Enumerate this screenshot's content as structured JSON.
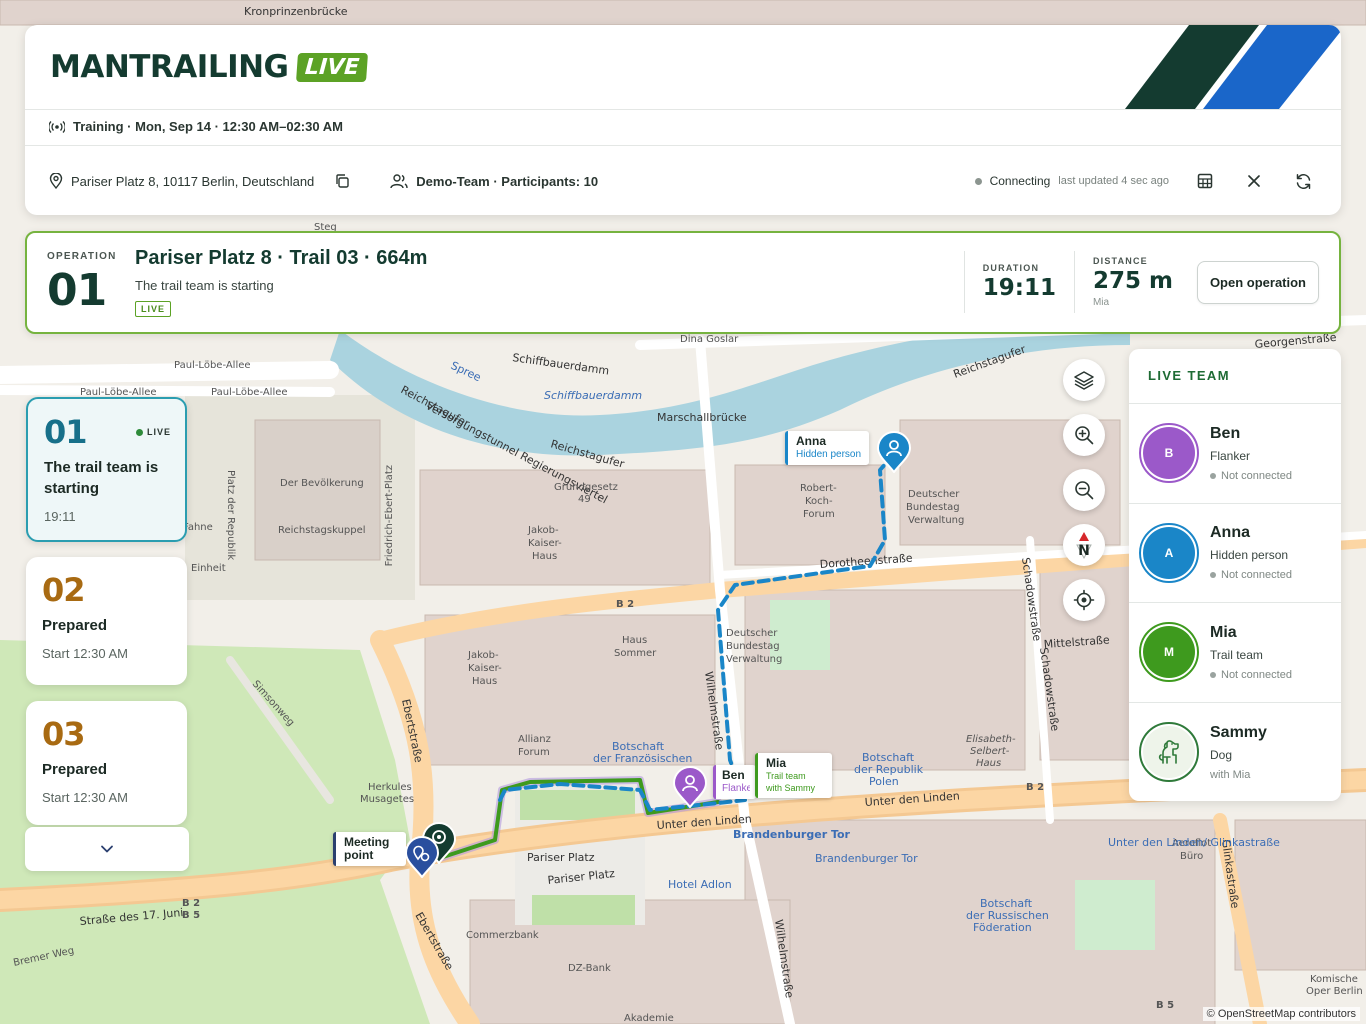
{
  "header": {
    "brand": "MANTRAILING",
    "brand_badge": "LIVE",
    "training": "Training · Mon, Sep 14 · 12:30 AM–02:30 AM",
    "address": "Pariser Platz 8, 10117 Berlin, Deutschland",
    "team": "Demo-Team · Participants: 10",
    "status": "Connecting",
    "updated": "last updated 4 sec ago",
    "colors": {
      "brand_dark": "#143b30",
      "brand_green": "#5ca225",
      "stripe_blue": "#1a66c9"
    }
  },
  "operation": {
    "label": "OPERATION",
    "number": "01",
    "title": "Pariser Platz 8 · Trail 03 · 664m",
    "subtitle": "The trail team is starting",
    "live": "LIVE",
    "duration_label": "DURATION",
    "duration": "19:11",
    "distance_label": "DISTANCE",
    "distance": "275 m",
    "distance_by": "Mia",
    "open_button": "Open operation"
  },
  "cards": [
    {
      "num": "01",
      "title": "The trail team is starting",
      "time": "19:11",
      "live": "LIVE"
    },
    {
      "num": "02",
      "title": "Prepared",
      "time": "Start 12:30 AM"
    },
    {
      "num": "03",
      "title": "Prepared",
      "time": "Start 12:30 AM"
    }
  ],
  "team": {
    "title": "LIVE TEAM",
    "members": [
      {
        "name": "Ben",
        "initial": "B",
        "role": "Flanker",
        "status": "Not connected",
        "color": "#9b59c9"
      },
      {
        "name": "Anna",
        "initial": "A",
        "role": "Hidden person",
        "status": "Not connected",
        "color": "#1a86c8"
      },
      {
        "name": "Mia",
        "initial": "M",
        "role": "Trail team",
        "status": "Not connected",
        "color": "#3e9a1e"
      },
      {
        "name": "Sammy",
        "initial": "",
        "role": "Dog",
        "status": "with Mia",
        "color": "#2f7a3a"
      }
    ]
  },
  "map": {
    "labels": {
      "kronprinzenbrucke": "Kronprinzenbrücke",
      "paul_lobe_1": "Paul-Löbe-Allee",
      "paul_lobe_2": "Paul-Löbe-Allee",
      "paul_lobe_3": "Paul-Löbe-Allee",
      "schiffbauerdamm": "Schiffbauerdamm",
      "schiffbauerdamm_blue": "Schiffbauerdamm",
      "reichstagufer": "Reichstagufer",
      "reichstagufer2": "Reichstagufer",
      "versorgungstunnel": "Versorgungstunnel Regierungsviertel",
      "marschallbrucke": "Marschallbrücke",
      "spree": "Spree",
      "reichstagufer_top": "Reichstagufer",
      "bevolkerung": "Der Bevölkerung",
      "reichstagskuppel": "Reichstagskuppel",
      "platz_republik": "Platz der Republik",
      "friedrich_ebert": "Friedrich-Ebert-Platz",
      "grundgesetz": "Grundgesetz",
      "grundgesetz_num": "49",
      "jakob_kaiser_1": "Jakob-",
      "jakob_kaiser_2": "Kaiser-",
      "jakob_kaiser_3": "Haus",
      "robert_koch_1": "Robert-",
      "robert_koch_2": "Koch-",
      "robert_koch_3": "Forum",
      "bundestag_1": "Deutscher",
      "bundestag_2": "Bundestag",
      "bundestag_3": "Verwaltung",
      "dorotheenstr": "Dorotheenstraße",
      "schadowstr": "Schadowstraße",
      "mittelstr": "Mittelstraße",
      "wilhelmstr": "Wilhelmstraße",
      "haus_sommer_1": "Haus",
      "haus_sommer_2": "Sommer",
      "allianz_1": "Allianz",
      "allianz_2": "Forum",
      "botschaft_fr_1": "Botschaft",
      "botschaft_fr_2": "der Französischen",
      "botschaft_pl_1": "Botschaft",
      "botschaft_pl_2": "der Republik",
      "botschaft_pl_3": "Polen",
      "unter_den_linden": "Unter den Linden",
      "unter_den_linden2": "Unter den Linden",
      "pariser_platz": "Pariser Platz",
      "pariser_platz2": "Pariser Platz",
      "brandenburger_tor": "Brandenburger Tor",
      "brandenburger_tor2": "Brandenburger Tor",
      "hotel_adlon": "Hotel Adlon",
      "ebertstr": "Ebertstraße",
      "ebertstr2": "Ebertstraße",
      "simsonweg": "Simsonweg",
      "herkules": "Herkules",
      "musagetes": "Musagetes",
      "strasse_17_juni": "Straße des 17. Juni",
      "bremer_weg": "Bremer Weg",
      "commerzbank": "Commerzbank",
      "dz_bank": "DZ-Bank",
      "akademie": "Akademie",
      "botschaft_ru_1": "Botschaft",
      "botschaft_ru_2": "der Russischen",
      "botschaft_ru_3": "Föderation",
      "aeroflot_1": "Aeroflot",
      "aeroflot_2": "Büro",
      "glinkastr": "Glinkastraße",
      "glinkastr_stop": "Unter den Linden/ Glinkastraße",
      "elisabeth_1": "Elisabeth-",
      "elisabeth_2": "Selbert-",
      "elisabeth_3": "Haus",
      "georgenstr": "Georgenstraße",
      "dina_goslar": "Dina Goslar",
      "komische_oper_1": "Komische",
      "komische_oper_2": "Oper Berlin",
      "fahne_1": "Fahne",
      "fahne_2": "Einheit",
      "steg": "Steg",
      "b2": "B 2",
      "b5": "B 5"
    },
    "markers": {
      "anna_name": "Anna",
      "anna_role": "Hidden person",
      "mia_name": "Mia",
      "mia_role": "Trail team with Sammy",
      "ben_name": "Ben",
      "ben_role": "Flanker",
      "meeting_point": "Meeting point"
    },
    "attribution": "© OpenStreetMap contributors"
  }
}
